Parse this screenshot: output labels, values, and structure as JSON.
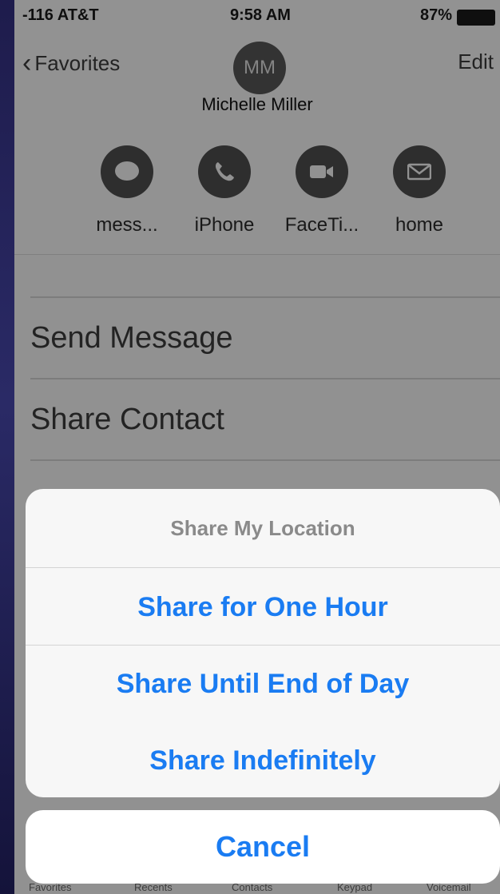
{
  "status_bar": {
    "carrier": "-116 AT&T",
    "time": "9:58 AM",
    "battery": "87%"
  },
  "nav": {
    "back_label": "Favorites",
    "edit_label": "Edit"
  },
  "contact": {
    "initials": "MM",
    "name": "Michelle Miller"
  },
  "actions": [
    {
      "label": "mess...",
      "icon": "message-icon"
    },
    {
      "label": "iPhone",
      "icon": "phone-icon"
    },
    {
      "label": "FaceTi...",
      "icon": "video-icon"
    },
    {
      "label": "home",
      "icon": "mail-icon"
    }
  ],
  "list": {
    "items": [
      "Send Message",
      "Share Contact"
    ]
  },
  "action_sheet": {
    "title": "Share My Location",
    "options": [
      "Share for One Hour",
      "Share Until End of Day",
      "Share Indefinitely"
    ],
    "cancel": "Cancel"
  },
  "tab_bar": {
    "tabs": [
      "Favorites",
      "Recents",
      "Contacts",
      "Keypad",
      "Voicemail"
    ]
  },
  "colors": {
    "accent": "#1a7cf2",
    "overlay": "rgba(0,0,0,0.40)",
    "frame": "#0e0d2c"
  }
}
